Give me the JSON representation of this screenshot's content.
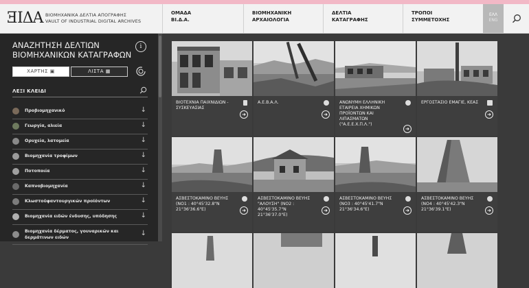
{
  "header": {
    "logo_mark": "ƎΙΔΑ",
    "logo_line1": "ΒΙΟΜΗΧΑΝΙΚΑ ΔΕΛΤΙΑ ΑΠΟΓΡΑΦΗΣ",
    "logo_line2": "VAULT OF INDUSTRIAL DIGITAL ARCHIVES",
    "nav": [
      {
        "line1": "ΟΜΑΔΑ",
        "line2": "ΒΙ.Δ.Α."
      },
      {
        "line1": "ΒΙΟΜΗΧΑΝΙΚΗ",
        "line2": "ΑΡΧΑΙΟΛΟΓΙΑ"
      },
      {
        "line1": "ΔΕΛΤΙΑ",
        "line2": "ΚΑΤΑΓΡΑΦΗΣ"
      },
      {
        "line1": "ΤΡΟΠΟΙ",
        "line2": "ΣΥΜΜΕΤΟΧΗΣ"
      }
    ],
    "lang_el": "ΕΛΛ",
    "lang_en": "ENG"
  },
  "sidebar": {
    "title1": "ΑΝΑΖΗΤΗΣΗ ΔΕΛΤΙΩΝ",
    "title2": "ΒΙΟΜΗΧΑΝΙΚΩΝ ΚΑΤΑΓΡΑΦΩΝ",
    "info": "i",
    "map_label": "ΧΑΡΤΗΣ",
    "list_label": "ΛΙΣΤΑ",
    "keywords_label": "ΛΕΞΙ ΚΛΕΙΔΙ",
    "categories": [
      "Προβιομηχανικό",
      "Γεωργία, αλιεία",
      "Ορυχεία, λατομεία",
      "Βιομηχανία τροφίμων",
      "Ποτοποιία",
      "Καπνοβιομηχανία",
      "Κλωστοϋφαντουργικών προϊόντων",
      "Βιομηχανία ειδών ένδυσης, υπόδησης",
      "Βιομηχανία δέρματος, γουναρικών και δερμάτινων ειδών"
    ]
  },
  "cards": [
    {
      "title": "ΒΙΟΤΕΧΝΙΑ ΠΑΙΧΝΙΔΙΩΝ - ΣΥΣΚΕΥΑΣΙΑΣ"
    },
    {
      "title": "Α.Ε.Β.Α.Λ."
    },
    {
      "title": "ΑΝΩΝΥΜΗ ΕΛΛΗΝΙΚΗ ΕΤΑΙΡΕΙΑ ΧΗΜΙΚΩΝ ΠΡΟΪΟΝΤΩΝ ΚΑΙ ΛΙΠΑΣΜΑΤΩΝ (\"Α.Ε.Ε.Χ.Π.Λ.\")"
    },
    {
      "title": "ΕΡΓΟΣΤΑΣΙΟ ΕΜΑΓΙΕ, ΚΕΑΣ"
    },
    {
      "title": "ΑΣΒΕΣΤΟΚΑΜΙΝΟ ΒΕΥΗΣ (ΝΟ1 : 40°45'32.8\"N 21°36'36.6\"E)"
    },
    {
      "title": "ΑΣΒΕΣΤΟΚΑΜΙΝΟ ΒΕΥΗΣ \"ΑΛΟΥΣΗ\" (ΝΟ2 : 40°45'35.7\"N 21°36'37.0\"E)"
    },
    {
      "title": "ΑΣΒΕΣΤΟΚΑΜΙΝΟ ΒΕΥΗΣ (ΝΟ3 : 40°45'41.7\"N 21°36'34.6\"E)"
    },
    {
      "title": "ΑΣΒΕΣΤΟΚΑΜΙΝΟ ΒΕΥΗΣ (ΝΟ4 : 40°45'42.3\"N 21°36'39.1\"E)"
    }
  ],
  "colors": {
    "accent_bar": "#f2b8c6",
    "sidebar_bg": "#262626",
    "card_caption_bg": "#3e3e3e"
  }
}
